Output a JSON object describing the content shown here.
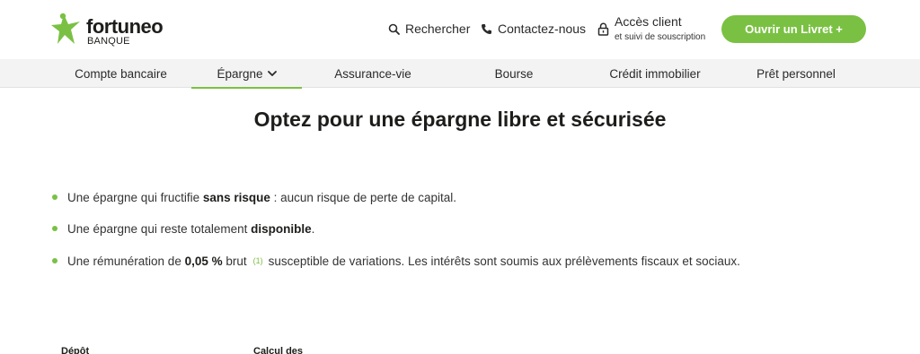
{
  "brand": {
    "name": "fortuneo",
    "sub": "BANQUE",
    "logo_icon": "star-person-icon",
    "accent_color": "#7ac143"
  },
  "header": {
    "search_label": "Rechercher",
    "contact_label": "Contactez-nous",
    "access_title": "Accès client",
    "access_subtitle": "et suivi de souscription",
    "cta_label": "Ouvrir un Livret +"
  },
  "nav": {
    "items": [
      {
        "label": "Compte bancaire"
      },
      {
        "label": "Épargne",
        "active": true,
        "icon": "chevron-down-icon"
      },
      {
        "label": "Assurance-vie"
      },
      {
        "label": "Bourse"
      },
      {
        "label": "Crédit immobilier"
      },
      {
        "label": "Prêt personnel"
      }
    ]
  },
  "main": {
    "title": "Optez pour une épargne libre et sécurisée",
    "bullets": [
      {
        "pre": "Une épargne qui fructifie ",
        "bold": "sans risque",
        "post": " : aucun risque de perte de capital."
      },
      {
        "pre": "Une épargne qui reste totalement ",
        "bold": "disponible",
        "post": "."
      },
      {
        "pre": "Une rémunération de ",
        "bold": "0,05 %",
        "mid": " brut",
        "note": "(1)",
        "post": "susceptible de variations. Les intérêts sont soumis aux prélèvements fiscaux et sociaux."
      }
    ],
    "bottom_labels": [
      "Dépôt",
      "Calcul des"
    ]
  }
}
